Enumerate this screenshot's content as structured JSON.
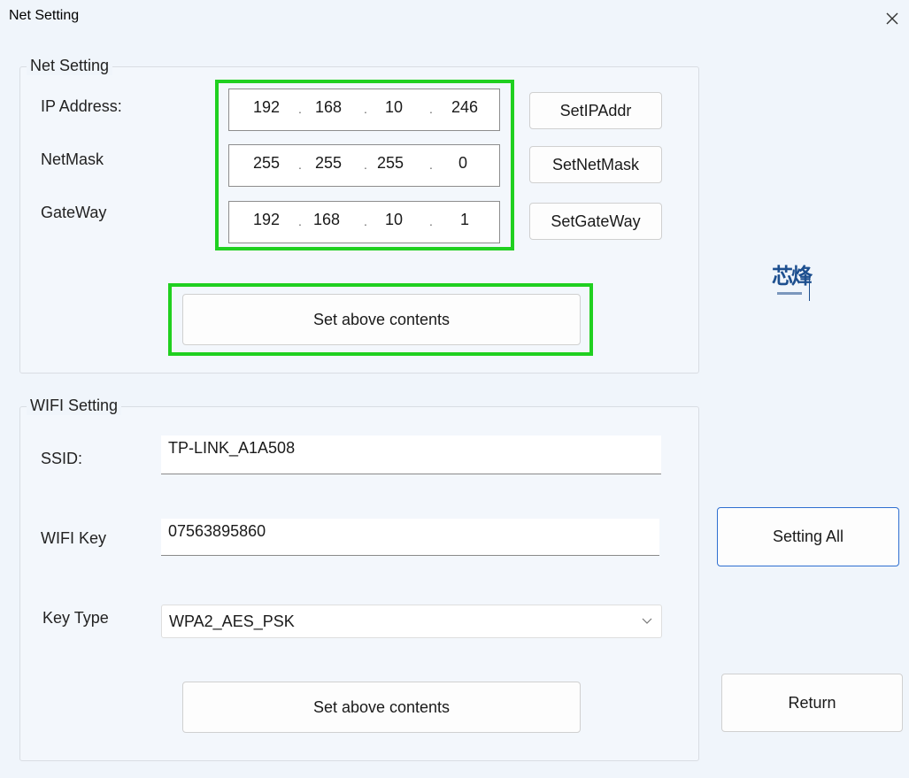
{
  "window": {
    "title": "Net Setting"
  },
  "net_setting": {
    "group_title": "Net Setting",
    "ip_label": "IP Address:",
    "netmask_label": "NetMask",
    "gateway_label": "GateWay",
    "ip": [
      "192",
      "168",
      "10",
      "246"
    ],
    "netmask": [
      "255",
      "255",
      "255",
      "0"
    ],
    "gateway": [
      "192",
      "168",
      "10",
      "1"
    ],
    "set_ip_button": "SetIPAddr",
    "set_netmask_button": "SetNetMask",
    "set_gateway_button": "SetGateWay",
    "apply_button": "Set above contents"
  },
  "wifi_setting": {
    "group_title": "WIFI Setting",
    "ssid_label": "SSID:",
    "ssid_value": "TP-LINK_A1A508",
    "key_label": "WIFI Key",
    "key_value": "07563895860",
    "key_type_label": "Key Type",
    "key_type_value": "WPA2_AES_PSK",
    "apply_button": "Set above contents"
  },
  "actions": {
    "setting_all": "Setting All",
    "return": "Return"
  },
  "logo": {
    "icon": "logo-icon",
    "text": "芯烽"
  },
  "colors": {
    "highlight": "#20d020",
    "focus_border": "#2f6fd0"
  }
}
